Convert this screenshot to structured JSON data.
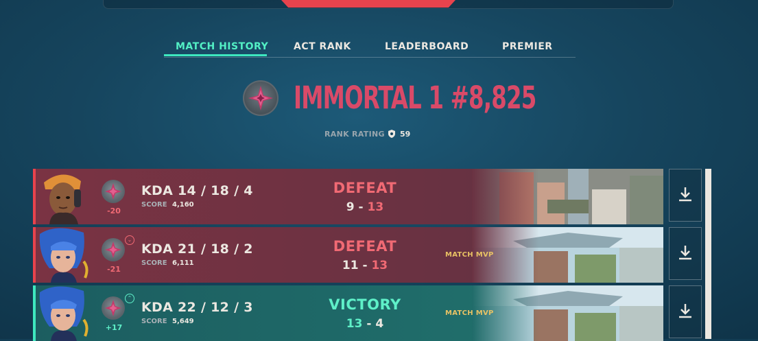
{
  "tabs": [
    {
      "label": "MATCH HISTORY",
      "active": true
    },
    {
      "label": "ACT RANK",
      "active": false
    },
    {
      "label": "LEADERBOARD",
      "active": false
    },
    {
      "label": "PREMIER",
      "active": false
    }
  ],
  "rank": {
    "title": "IMMORTAL 1 #8,825",
    "emblem_icon": "immortal-rank-icon",
    "rating_label": "RANK RATING",
    "rating_icon": "shield-icon",
    "rating_value": "59"
  },
  "matches": [
    {
      "outcome": "defeat",
      "agent_icon": "agent-portrait-orange",
      "rr_change": "-20",
      "trend": "",
      "kda": "KDA 14 / 18 / 4",
      "score_label": "SCORE",
      "score": "4,160",
      "result": "DEFEAT",
      "our_score": "9",
      "separator": "-",
      "their_score": "13",
      "mvp": "",
      "map": "city-map-thumbnail"
    },
    {
      "outcome": "defeat",
      "agent_icon": "agent-portrait-blue",
      "rr_change": "-21",
      "trend": "down",
      "kda": "KDA 21 / 18 / 2",
      "score_label": "SCORE",
      "score": "6,111",
      "result": "DEFEAT",
      "our_score": "11",
      "separator": "-",
      "their_score": "13",
      "mvp": "MATCH MVP",
      "map": "coastal-map-thumbnail"
    },
    {
      "outcome": "victory",
      "agent_icon": "agent-portrait-blue",
      "rr_change": "+17",
      "trend": "up",
      "kda": "KDA 22 / 12 / 3",
      "score_label": "SCORE",
      "score": "5,649",
      "result": "VICTORY",
      "our_score": "13",
      "separator": "-",
      "their_score": "4",
      "mvp": "MATCH MVP",
      "map": "coastal-map-thumbnail"
    }
  ],
  "download_icon": "download-icon",
  "colors": {
    "accent_teal": "#3ee8bf",
    "defeat_red": "#f16a74",
    "rank_pink": "#d94a68",
    "mvp_gold": "#e8c264"
  }
}
